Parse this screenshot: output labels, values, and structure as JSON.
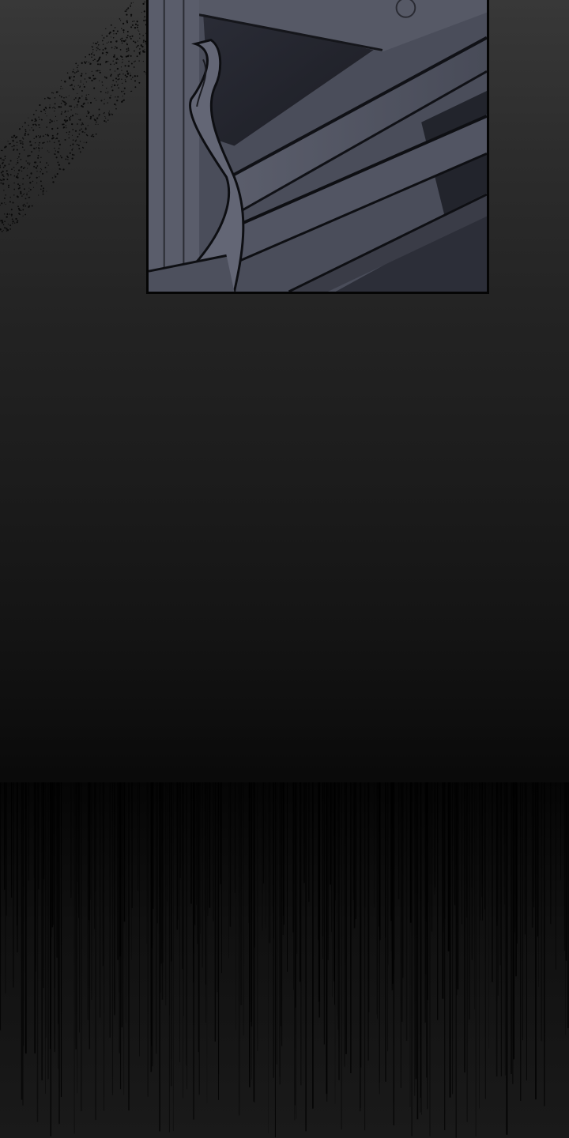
{
  "scene": {
    "panel_subject": "window-frame",
    "effect": "vertical-speed-lines",
    "colors": {
      "background_top": "#383838",
      "background_bottom": "#090909",
      "panel_fill": "#3c3f4c",
      "panel_border": "#050505",
      "speedline": "#000000"
    }
  }
}
